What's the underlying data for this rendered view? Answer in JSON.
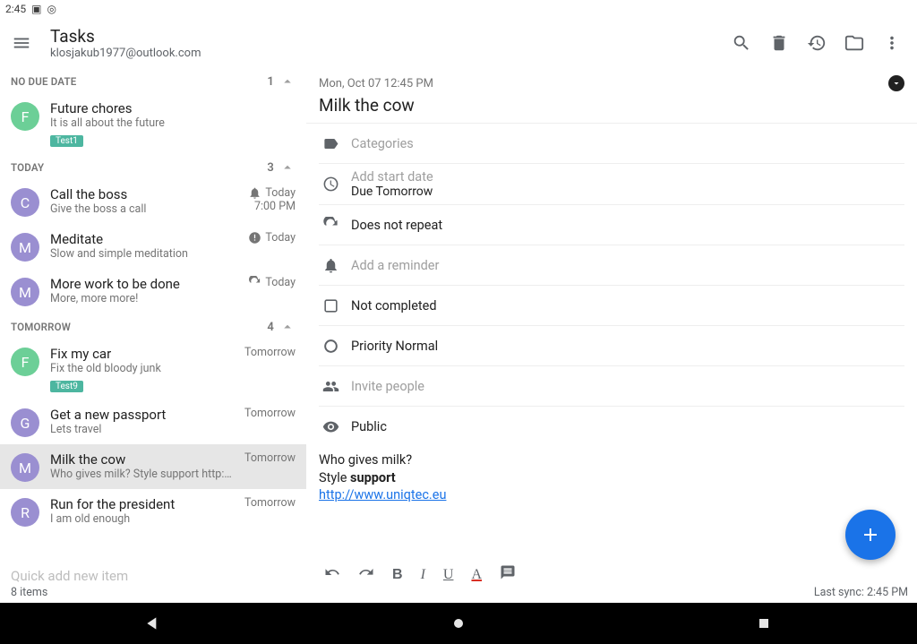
{
  "status": {
    "time": "2:45"
  },
  "header": {
    "title": "Tasks",
    "subtitle": "klosjakub1977@outlook.com"
  },
  "sections": [
    {
      "name": "NO DUE DATE",
      "count": "1",
      "tasks": [
        {
          "avatar": "F",
          "avatar_color": "green",
          "title": "Future chores",
          "sub": "It is all about the future",
          "tag": "Test1"
        }
      ]
    },
    {
      "name": "TODAY",
      "count": "3",
      "tasks": [
        {
          "avatar": "C",
          "avatar_color": "purple",
          "title": "Call the boss",
          "sub": "Give the boss a call",
          "right_icon": "bell",
          "right1": "Today",
          "right2": "7:00 PM"
        },
        {
          "avatar": "M",
          "avatar_color": "purple",
          "title": "Meditate",
          "sub": "Slow and simple meditation",
          "right_icon": "alert",
          "right1": "Today"
        },
        {
          "avatar": "M",
          "avatar_color": "purple",
          "title": "More work to be done",
          "sub": "More, more more!",
          "right_icon": "repeat",
          "right1": "Today"
        }
      ]
    },
    {
      "name": "TOMORROW",
      "count": "4",
      "tasks": [
        {
          "avatar": "F",
          "avatar_color": "green",
          "title": "Fix my car",
          "sub": "Fix the old bloody junk",
          "tag": "Test9",
          "right1": "Tomorrow"
        },
        {
          "avatar": "G",
          "avatar_color": "purple",
          "title": "Get a new passport",
          "sub": "Lets travel",
          "right1": "Tomorrow"
        },
        {
          "avatar": "M",
          "avatar_color": "purple",
          "title": "Milk the cow",
          "sub": "Who gives milk? Style support http://www.uni..",
          "right1": "Tomorrow",
          "selected": true
        },
        {
          "avatar": "R",
          "avatar_color": "purple",
          "title": "Run for the president",
          "sub": "I am old enough",
          "right1": "Tomorrow"
        }
      ]
    }
  ],
  "quick_add_placeholder": "Quick add new item",
  "items_count": "8 items",
  "detail": {
    "datetime": "Mon, Oct 07 12:45 PM",
    "title": "Milk the cow",
    "categories_label": "Categories",
    "start_label": "Add start date",
    "due_label": "Due Tomorrow",
    "repeat_label": "Does not repeat",
    "reminder_label": "Add a reminder",
    "completed_label": "Not completed",
    "priority_label": "Priority Normal",
    "invite_label": "Invite people",
    "visibility_label": "Public",
    "notes_line1": "Who gives milk?",
    "notes_line2a": "Style ",
    "notes_line2b": "support",
    "notes_link": "http://www.uniqtec.eu"
  },
  "last_sync": "Last sync: 2:45 PM"
}
